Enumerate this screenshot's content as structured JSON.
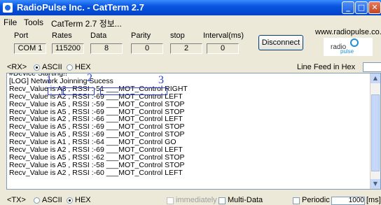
{
  "title": "RadioPulse Inc. - CatTerm 2.7",
  "menu": [
    "File",
    "Tools",
    "CatTerm 2.7 정보..."
  ],
  "port_settings": {
    "headers": [
      "Port",
      "Rates",
      "Data",
      "Parity",
      "stop",
      "Interval(ms)"
    ],
    "values": [
      "COM 1",
      "115200",
      "8",
      "0",
      "2",
      "0"
    ]
  },
  "disconnect_label": "Disconnect",
  "website": "www.radiopulse.co.kr",
  "logo": {
    "word": "radio",
    "sub": "pulse"
  },
  "rx": {
    "label": "<RX>",
    "ascii": "ASCII",
    "hex": "HEX",
    "mode": "ASCII",
    "line_feed_label": "Line Feed in Hex",
    "line_feed_value": ""
  },
  "rx_lines": [
    "#Device Starting!!",
    "[LOG] Network Joinning Sucess",
    "Recv_Value is A3 , RSSI :-51 ___MOT_Control RIGHT",
    "Recv_Value is A2 , RSSI :-69 ___MOT_Control LEFT",
    "Recv_Value is A5 , RSSI :-59 ___MOT_Control STOP",
    "Recv_Value is A5 , RSSI :-69 ___MOT_Control STOP",
    "Recv_Value is A2 , RSSI :-66 ___MOT_Control LEFT",
    "Recv_Value is A5 , RSSI :-69 ___MOT_Control STOP",
    "Recv_Value is A5 , RSSI :-69 ___MOT_Control STOP",
    "Recv_Value is A1 , RSSI :-64 ___MOT_Control GO",
    "Recv_Value is A2 , RSSI :-69 ___MOT_Control LEFT",
    "Recv_Value is A5 , RSSI :-62 ___MOT_Control STOP",
    "Recv_Value is A5 , RSSI :-58 ___MOT_Control STOP",
    "Recv_Value is A2 , RSSI :-60 ___MOT_Control LEFT"
  ],
  "annotations": [
    "1",
    "2",
    "3"
  ],
  "tx": {
    "label": "<TX>",
    "ascii": "ASCII",
    "hex": "HEX",
    "mode": "HEX",
    "immediately": "immediately",
    "multi_data": "Multi-Data",
    "periodic": "Periodic",
    "period_value": "1000",
    "period_unit": "[ms]"
  }
}
